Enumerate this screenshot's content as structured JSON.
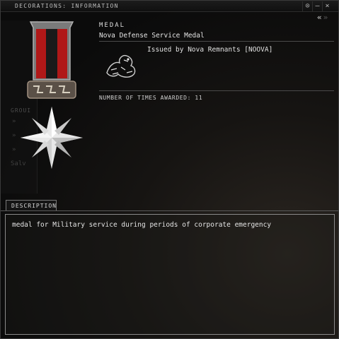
{
  "window": {
    "title": "DECORATIONS: INFORMATION",
    "options_glyph": "⊙",
    "minimize_glyph": "–",
    "close_glyph": "×",
    "back_glyph": "«",
    "forward_glyph": "»"
  },
  "background_panel": {
    "label": "GROUI",
    "rows": [
      "»",
      "»",
      "»"
    ],
    "extra": "Salv"
  },
  "medal": {
    "heading": "MEDAL",
    "name": "Nova Defense Service Medal",
    "issued_by": "Issued by Nova Remnants [NOOVA]",
    "awarded": "NUMBER OF TIMES AWARDED: 11",
    "ribbon_colors": [
      "#b01818",
      "#1a1a1a"
    ],
    "icons": [
      "medal-ribbon-icon",
      "star-medal-icon",
      "corporation-dragon-logo"
    ]
  },
  "description": {
    "tab_label": "DESCRIPTION",
    "text": "medal for Military service during periods of corporate emergency"
  }
}
